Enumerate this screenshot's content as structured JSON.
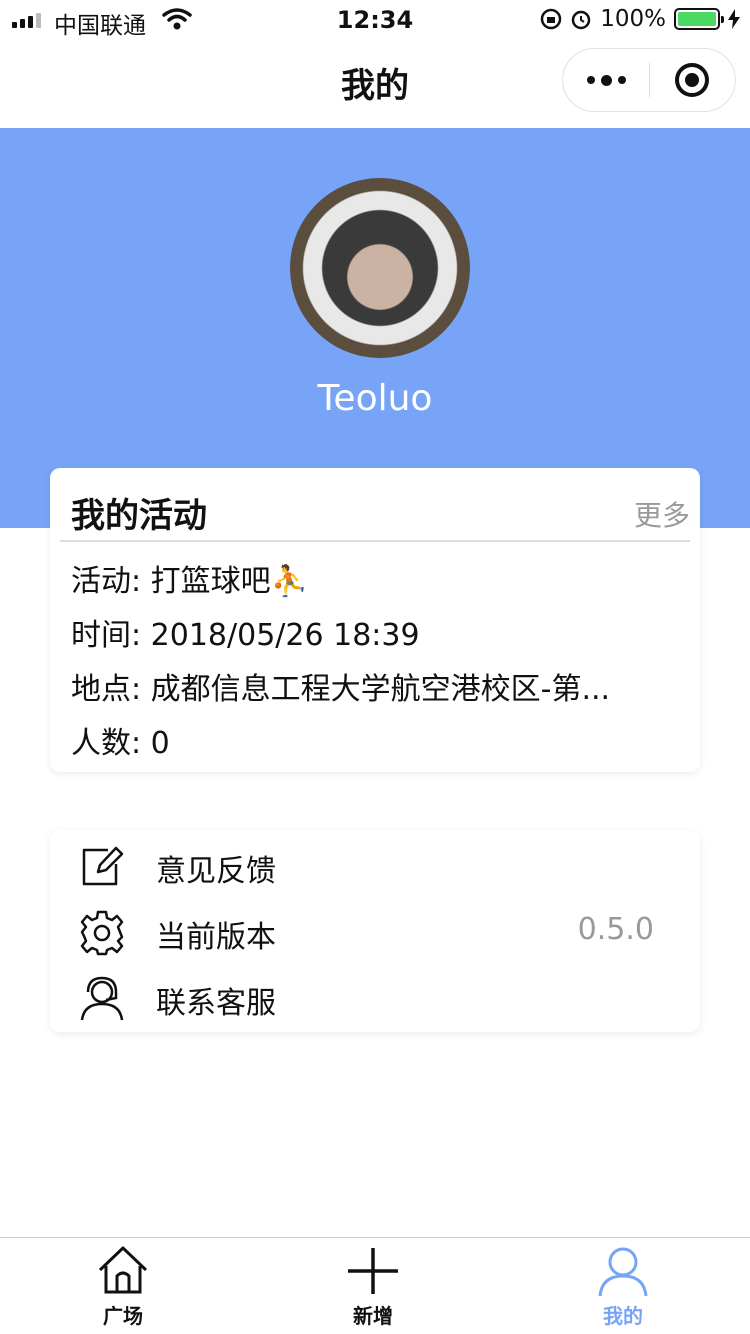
{
  "status_bar": {
    "carrier": "中国联通",
    "time": "12:34",
    "battery": "100%"
  },
  "nav": {
    "title": "我的"
  },
  "profile": {
    "username": "Teoluo",
    "header_color": "#78a4f8"
  },
  "activity": {
    "title": "我的活动",
    "more": "更多",
    "rows": [
      {
        "key": "活动:",
        "value": "打篮球吧⛹"
      },
      {
        "key": "时间:",
        "value": "2018/05/26 18:39"
      },
      {
        "key": "地点:",
        "value": "成都信息工程大学航空港校区-第..."
      },
      {
        "key": "人数:",
        "value": "0"
      }
    ]
  },
  "menu": [
    {
      "label": "意见反馈",
      "icon": "edit-icon"
    },
    {
      "label": "当前版本",
      "icon": "gear-icon",
      "value": "0.5.0"
    },
    {
      "label": "联系客服",
      "icon": "headset-icon"
    }
  ],
  "tabbar": {
    "active_color": "#78a4f8",
    "tabs": [
      {
        "label": "广场",
        "icon": "home-icon"
      },
      {
        "label": "新增",
        "icon": "plus-icon"
      },
      {
        "label": "我的",
        "icon": "user-icon",
        "active": true
      }
    ]
  }
}
